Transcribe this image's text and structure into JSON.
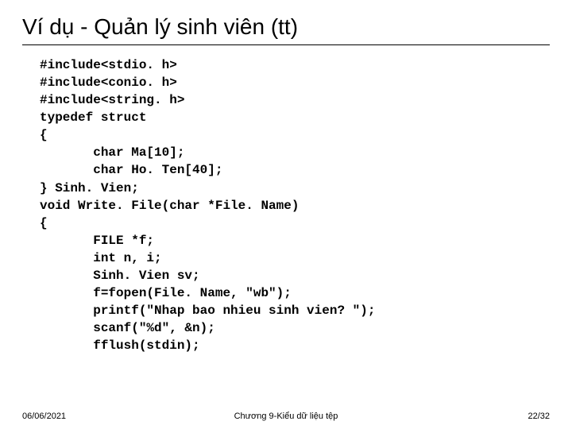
{
  "title": "Ví dụ - Quản lý sinh viên (tt)",
  "code": "#include<stdio. h>\n#include<conio. h>\n#include<string. h>\ntypedef struct\n{\n       char Ma[10];\n       char Ho. Ten[40];\n} Sinh. Vien;\nvoid Write. File(char *File. Name)\n{\n       FILE *f;\n       int n, i;\n       Sinh. Vien sv;\n       f=fopen(File. Name, \"wb\");\n       printf(\"Nhap bao nhieu sinh vien? \");\n       scanf(\"%d\", &n);\n       fflush(stdin);",
  "footer": {
    "date": "06/06/2021",
    "chapter": "Chương 9-Kiểu dữ liệu tệp",
    "page": "22/32"
  }
}
